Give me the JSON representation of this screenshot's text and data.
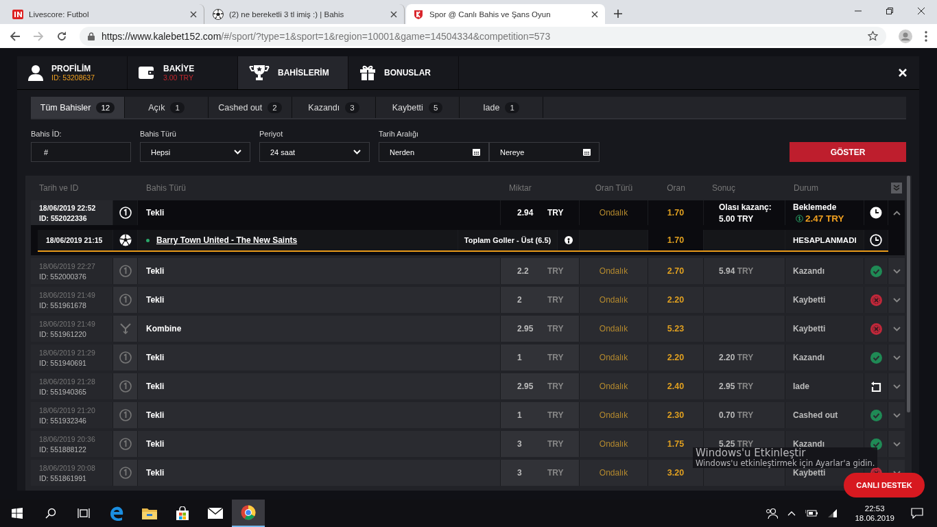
{
  "browser": {
    "tabs": [
      {
        "kind": "livescore",
        "title": "Livescore: Futbol",
        "selected": false
      },
      {
        "kind": "ball",
        "title": "(2) ne bereketli 3 tl imiş :) | Bahis",
        "selected": false
      },
      {
        "kind": "shield",
        "title": "Spor @ Canlı Bahis ve Şans Oyun",
        "selected": true
      }
    ],
    "url": {
      "origin": "https://www.kalebet152.com",
      "path": "/#/sport/?type=1&sport=1&region=10001&game=14504334&competition=573"
    }
  },
  "account_tabs": [
    {
      "kind": "profile",
      "label": "PROFİLİM",
      "sub": "ID: 53208637",
      "selected": false
    },
    {
      "kind": "balance",
      "label": "BAKİYE",
      "sub": "3.00 TRY",
      "selected": false
    },
    {
      "kind": "bets",
      "label": "BAHİSLERİM",
      "selected": true
    },
    {
      "kind": "bonus",
      "label": "BONUSLAR",
      "selected": false
    }
  ],
  "bet_filters": [
    {
      "label": "Tüm Bahisler",
      "count": "12",
      "selected": true
    },
    {
      "label": "Açık",
      "count": "1",
      "selected": false
    },
    {
      "label": "Cashed out",
      "count": "2",
      "selected": false
    },
    {
      "label": "Kazandı",
      "count": "3",
      "selected": false
    },
    {
      "label": "Kaybetti",
      "count": "5",
      "selected": false
    },
    {
      "label": "Iade",
      "count": "1",
      "selected": false
    }
  ],
  "filters": {
    "bet_id": {
      "label": "Bahis İD:",
      "placeholder": "#"
    },
    "bet_type": {
      "label": "Bahis Türü",
      "value": "Hepsi"
    },
    "period": {
      "label": "Periyot",
      "value": "24 saat"
    },
    "date_range": {
      "label": "Tarih Aralığı",
      "from": "Nerden",
      "to": "Nereye"
    },
    "submit": "GÖSTER"
  },
  "table": {
    "columns": [
      "Tarih ve ID",
      "Bahis Türü",
      "Miktar",
      "Oran Türü",
      "Oran",
      "Sonuç",
      "Durum"
    ],
    "rows": [
      {
        "date": "18/06/2019 22:52",
        "id": "ID: 552022336",
        "bet_type": {
          "kind": "single",
          "text": "Tekli"
        },
        "amount": "2.94",
        "currency": "TRY",
        "odds_type": "Ondalık",
        "odds": "1.70",
        "result_note": "Olası kazanç:",
        "result_amount": "5.00 TRY",
        "status": {
          "kind": "pending",
          "text": "Beklemede"
        },
        "cashout": "2.47 TRY",
        "expanded": true,
        "selections": [
          {
            "date": "18/06/2019 21:15",
            "event": "Barry Town United - The New Saints",
            "market": "Toplam Goller - Üst (6.5)",
            "odds": "1.70",
            "status": "HESAPLANMADI"
          }
        ]
      },
      {
        "date": "18/06/2019 22:27",
        "id": "ID: 552000376",
        "bet_type": {
          "kind": "single",
          "text": "Tekli"
        },
        "amount": "2.2",
        "currency": "TRY",
        "odds_type": "Ondalık",
        "odds": "2.70",
        "result_amount": "5.94",
        "result_currency": "TRY",
        "status": {
          "kind": "won",
          "text": "Kazandı"
        },
        "expanded": false
      },
      {
        "date": "18/06/2019 21:49",
        "id": "ID: 551961678",
        "bet_type": {
          "kind": "single",
          "text": "Tekli"
        },
        "amount": "2",
        "currency": "TRY",
        "odds_type": "Ondalık",
        "odds": "2.20",
        "status": {
          "kind": "lost",
          "text": "Kaybetti"
        },
        "expanded": false
      },
      {
        "date": "18/06/2019 21:49",
        "id": "ID: 551961220",
        "bet_type": {
          "kind": "combo",
          "text": "Kombine"
        },
        "amount": "2.95",
        "currency": "TRY",
        "odds_type": "Ondalık",
        "odds": "5.23",
        "status": {
          "kind": "lost",
          "text": "Kaybetti"
        },
        "expanded": false
      },
      {
        "date": "18/06/2019 21:29",
        "id": "ID: 551940691",
        "bet_type": {
          "kind": "single",
          "text": "Tekli"
        },
        "amount": "1",
        "currency": "TRY",
        "odds_type": "Ondalık",
        "odds": "2.20",
        "result_amount": "2.20",
        "result_currency": "TRY",
        "status": {
          "kind": "won",
          "text": "Kazandı"
        },
        "expanded": false
      },
      {
        "date": "18/06/2019 21:28",
        "id": "ID: 551940365",
        "bet_type": {
          "kind": "single",
          "text": "Tekli"
        },
        "amount": "2.95",
        "currency": "TRY",
        "odds_type": "Ondalık",
        "odds": "2.40",
        "result_amount": "2.95",
        "result_currency": "TRY",
        "status": {
          "kind": "refund",
          "text": "Iade"
        },
        "expanded": false
      },
      {
        "date": "18/06/2019 21:20",
        "id": "ID: 551932346",
        "bet_type": {
          "kind": "single",
          "text": "Tekli"
        },
        "amount": "1",
        "currency": "TRY",
        "odds_type": "Ondalık",
        "odds": "2.30",
        "result_amount": "0.70",
        "result_currency": "TRY",
        "status": {
          "kind": "won",
          "text": "Cashed out"
        },
        "expanded": false
      },
      {
        "date": "18/06/2019 20:36",
        "id": "ID: 551888122",
        "bet_type": {
          "kind": "single",
          "text": "Tekli"
        },
        "amount": "3",
        "currency": "TRY",
        "odds_type": "Ondalık",
        "odds": "1.75",
        "result_amount": "5.25",
        "result_currency": "TRY",
        "status": {
          "kind": "won",
          "text": "Kazandı"
        },
        "expanded": false
      },
      {
        "date": "18/06/2019 20:08",
        "id": "ID: 551861991",
        "bet_type": {
          "kind": "single",
          "text": "Tekli"
        },
        "amount": "3",
        "currency": "TRY",
        "odds_type": "Ondalık",
        "odds": "3.20",
        "status": {
          "kind": "lost",
          "text": "Kaybetti"
        },
        "expanded": false
      }
    ]
  },
  "support_button": "CANLI DESTEK",
  "activation_notice": {
    "title": "Windows'u Etkinleştir",
    "text": "Windows'u etkinleştirmek için Ayarlar'a gidin."
  },
  "taskbar": {
    "apps": [
      {
        "kind": "edge",
        "selected": false
      },
      {
        "kind": "explorer",
        "selected": false
      },
      {
        "kind": "store",
        "selected": false
      },
      {
        "kind": "mail",
        "selected": false
      },
      {
        "kind": "chrome",
        "selected": true
      }
    ],
    "time": "22:53",
    "date": "18.06.2019"
  }
}
